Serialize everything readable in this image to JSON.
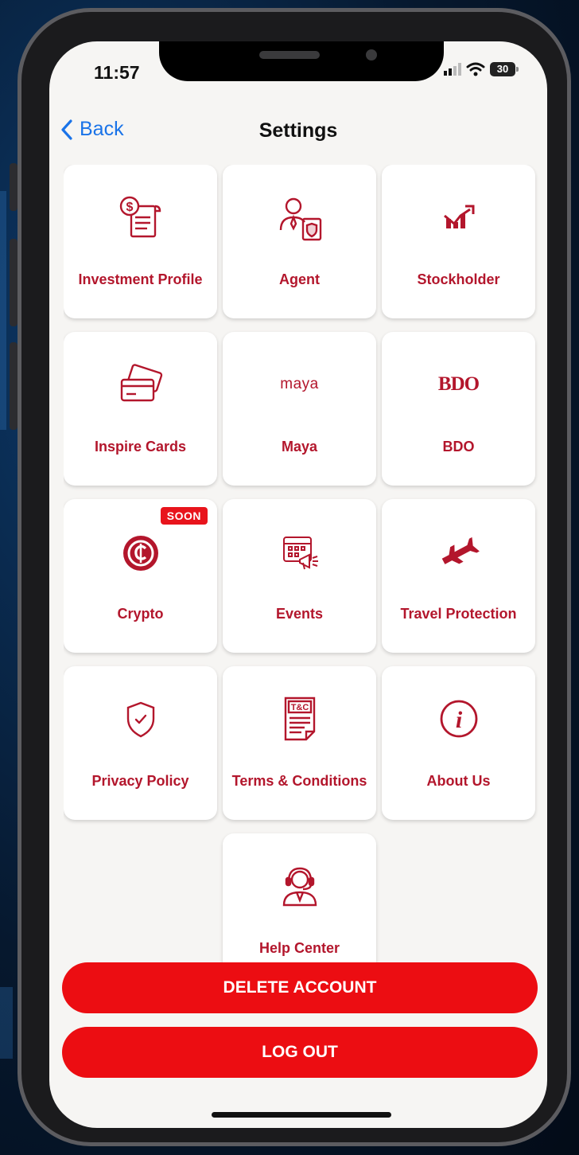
{
  "status_bar": {
    "time": "11:57",
    "battery": "30"
  },
  "nav": {
    "back_label": "Back",
    "title": "Settings"
  },
  "badge_text": "SOON",
  "tiles": [
    {
      "label": "Investment Profile",
      "icon": "document-dollar-icon"
    },
    {
      "label": "Agent",
      "icon": "agent-id-icon"
    },
    {
      "label": "Stockholder",
      "icon": "stock-chart-icon"
    },
    {
      "label": "Inspire Cards",
      "icon": "credit-cards-icon"
    },
    {
      "label": "Maya",
      "logo_text": "maya"
    },
    {
      "label": "BDO",
      "logo_text": "BDO"
    },
    {
      "label": "Crypto",
      "icon": "crypto-coin-icon",
      "badge": "SOON"
    },
    {
      "label": "Events",
      "icon": "calendar-megaphone-icon"
    },
    {
      "label": "Travel Protection",
      "icon": "airplane-icon"
    },
    {
      "label": "Privacy Policy",
      "icon": "shield-check-icon"
    },
    {
      "label": "Terms & Conditions",
      "icon": "terms-document-icon",
      "icon_text": "T&C"
    },
    {
      "label": "About Us",
      "icon": "info-icon"
    },
    {
      "label": "Help Center",
      "icon": "support-agent-icon"
    }
  ],
  "buttons": {
    "delete_account": "DELETE ACCOUNT",
    "log_out": "LOG OUT"
  },
  "colors": {
    "brand_red": "#b3162c",
    "button_red": "#ec0d12",
    "badge_red": "#e8141c",
    "link_blue": "#1a73e8"
  }
}
